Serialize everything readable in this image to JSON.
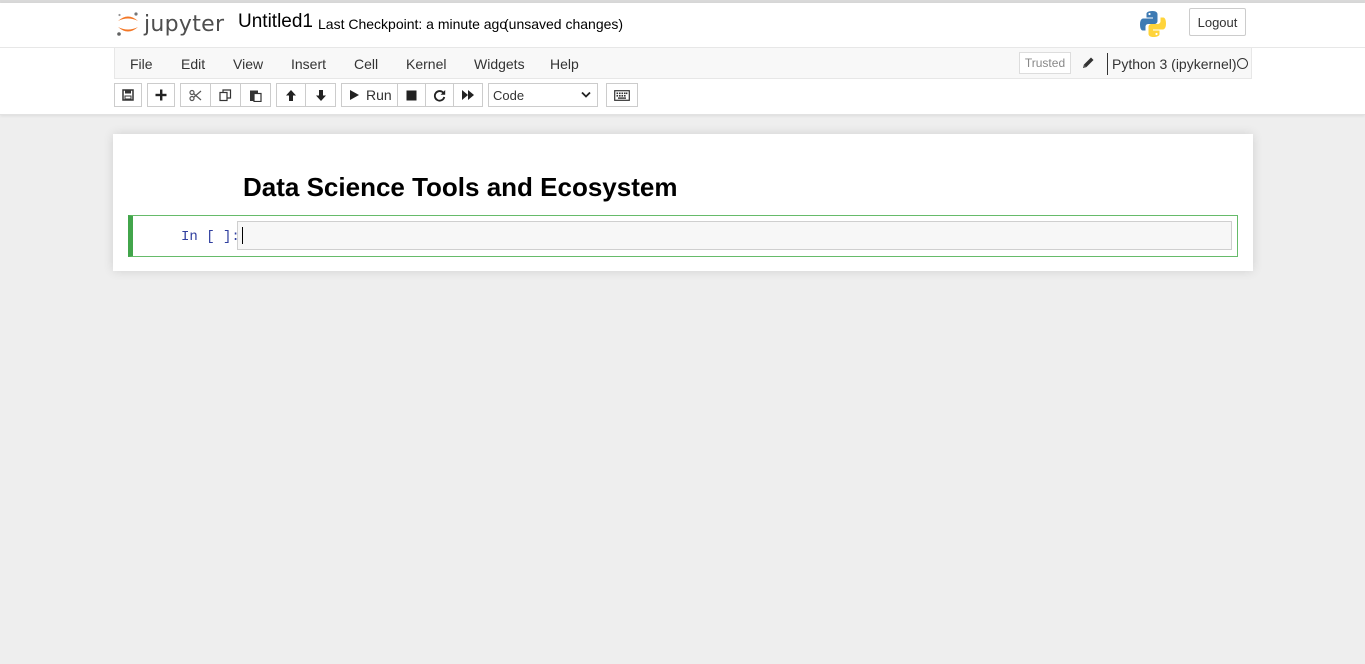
{
  "header": {
    "logo_text": "jupyter",
    "notebook_name": "Untitled1",
    "checkpoint": "Last Checkpoint: a minute ago",
    "autosave_status": "(unsaved changes)",
    "logout_label": "Logout"
  },
  "menubar": {
    "items": [
      "File",
      "Edit",
      "View",
      "Insert",
      "Cell",
      "Kernel",
      "Widgets",
      "Help"
    ],
    "trusted_label": "Trusted",
    "kernel_name": "Python 3 (ipykernel)"
  },
  "toolbar": {
    "run_label": "Run",
    "cell_type": "Code",
    "icons": [
      "save-icon",
      "plus-icon",
      "cut-icon",
      "copy-icon",
      "paste-icon",
      "arrow-up-icon",
      "arrow-down-icon",
      "play-icon",
      "stop-icon",
      "restart-icon",
      "fast-forward-icon",
      "keyboard-icon"
    ]
  },
  "notebook": {
    "heading": "Data Science Tools and Ecosystem",
    "cell_prompt": "In [ ]:"
  },
  "colors": {
    "jupyter_orange": "#f37726",
    "cell_border": "#42a54b",
    "prompt_blue": "#303f9f"
  }
}
